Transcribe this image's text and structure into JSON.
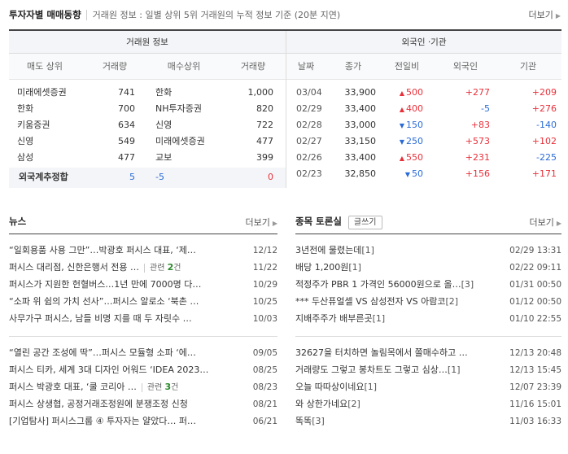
{
  "investor": {
    "title": "투자자별 매매동향",
    "description": "거래원 정보 : 일별 상위 5위 거래원의 누적 정보 기준 (20분 지연)",
    "more_label": "더보기",
    "broker_group_label": "거래원 정보",
    "foreign_group_label": "외국인 ·기관",
    "broker_headers": [
      "매도 상위",
      "거래량",
      "매수상위",
      "거래량"
    ],
    "foreign_headers": [
      "날짜",
      "종가",
      "전일비",
      "외국인",
      "기관"
    ],
    "brokers": [
      {
        "sell_name": "미래에셋증권",
        "sell_vol": "741",
        "buy_name": "한화",
        "buy_vol": "1,000"
      },
      {
        "sell_name": "한화",
        "sell_vol": "700",
        "buy_name": "NH투자증권",
        "buy_vol": "820"
      },
      {
        "sell_name": "키움증권",
        "sell_vol": "634",
        "buy_name": "신영",
        "buy_vol": "722"
      },
      {
        "sell_name": "신영",
        "sell_vol": "549",
        "buy_name": "미래에셋증권",
        "buy_vol": "477"
      },
      {
        "sell_name": "삼성",
        "sell_vol": "477",
        "buy_name": "교보",
        "buy_vol": "399"
      }
    ],
    "foreign_total": {
      "label": "외국계추정합",
      "sell": "5",
      "buy": "-5",
      "net": "0"
    },
    "daily": [
      {
        "date": "03/04",
        "close": "33,900",
        "dir": "up",
        "change": "500",
        "foreign": "+277",
        "inst": "+209"
      },
      {
        "date": "02/29",
        "close": "33,400",
        "dir": "up",
        "change": "400",
        "foreign": "-5",
        "inst": "+276"
      },
      {
        "date": "02/28",
        "close": "33,000",
        "dir": "down",
        "change": "150",
        "foreign": "+83",
        "inst": "-140"
      },
      {
        "date": "02/27",
        "close": "33,150",
        "dir": "down",
        "change": "250",
        "foreign": "+573",
        "inst": "+102"
      },
      {
        "date": "02/26",
        "close": "33,400",
        "dir": "up",
        "change": "550",
        "foreign": "+231",
        "inst": "-225"
      },
      {
        "date": "02/23",
        "close": "32,850",
        "dir": "down",
        "change": "50",
        "foreign": "+156",
        "inst": "+171"
      }
    ]
  },
  "news": {
    "title": "뉴스",
    "more_label": "더보기",
    "related_label": "관련",
    "related_suffix": "건",
    "items": [
      {
        "text": "“일회용품 사용 그만”…박광호 퍼시스 대표, ‘제…",
        "date": "12/12",
        "related": ""
      },
      {
        "text": "퍼시스 대리점, 신한은행서 전용 …",
        "date": "11/22",
        "related": "2"
      },
      {
        "text": "퍼시스가 지원한 헌혈버스…1년 만에 7000명 다…",
        "date": "10/29",
        "related": ""
      },
      {
        "text": "“소파 위 쉼의 가치 선사”…퍼시스 알로소 ‘북촌 …",
        "date": "10/25",
        "related": ""
      },
      {
        "text": "사무가구 퍼시스, 남들 비명 지를 때 두 자릿수 …",
        "date": "10/03",
        "related": ""
      },
      {
        "text": "“열린 공간 조성에 딱”…퍼시스 모듈형 소파 ‘에…",
        "date": "09/05",
        "related": ""
      },
      {
        "text": "퍼시스 티카, 세계 3대 디자인 어워드 ‘IDEA 2023…",
        "date": "08/25",
        "related": ""
      },
      {
        "text": "퍼시스 박광호 대표, ‘쿨 코리아 …",
        "date": "08/23",
        "related": "3"
      },
      {
        "text": "퍼시스 상생협, 공정거래조정원에 분쟁조정 신청",
        "date": "08/21",
        "related": ""
      },
      {
        "text": "[기업탐사] 퍼시스그룹 ④ 투자자는 얄았다… 퍼…",
        "date": "06/21",
        "related": ""
      }
    ]
  },
  "board": {
    "title": "종목 토론실",
    "write_label": "글쓰기",
    "more_label": "더보기",
    "items": [
      {
        "text": "3년전에 물렸는데",
        "count": "[1]",
        "date": "02/29 13:31"
      },
      {
        "text": "배당 1,200원",
        "count": "[1]",
        "date": "02/22 09:11"
      },
      {
        "text": "적정주가 PBR 1 가격인 56000원으로 올…",
        "count": "[3]",
        "date": "01/31 00:50"
      },
      {
        "text": "*** 두산퓨얼셀 VS 삼성전자 VS 아람코",
        "count": "[2]",
        "date": "01/12 00:50"
      },
      {
        "text": "지배주주가 배부른곳",
        "count": "[1]",
        "date": "01/10 22:55"
      },
      {
        "text": "32627을 터치하면 놀림목에서 쫄매수하고 …",
        "count": "",
        "date": "12/13 20:48"
      },
      {
        "text": "거래량도 그렇고 봉차트도 그렇고 심상…",
        "count": "[1]",
        "date": "12/13 15:45"
      },
      {
        "text": "오늘 따따상이네요",
        "count": "[1]",
        "date": "12/07 23:39"
      },
      {
        "text": "와 상한가네요",
        "count": "[2]",
        "date": "11/16 15:01"
      },
      {
        "text": "똑똑",
        "count": "[3]",
        "date": "11/03 16:33"
      }
    ]
  }
}
